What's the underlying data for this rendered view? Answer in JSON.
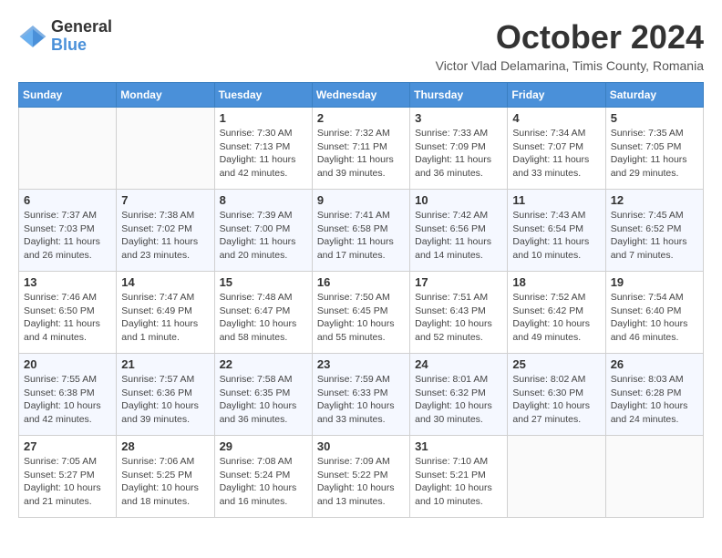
{
  "header": {
    "logo_general": "General",
    "logo_blue": "Blue",
    "month_title": "October 2024",
    "subtitle": "Victor Vlad Delamarina, Timis County, Romania"
  },
  "days_of_week": [
    "Sunday",
    "Monday",
    "Tuesday",
    "Wednesday",
    "Thursday",
    "Friday",
    "Saturday"
  ],
  "weeks": [
    [
      {
        "day": "",
        "info": ""
      },
      {
        "day": "",
        "info": ""
      },
      {
        "day": "1",
        "info": "Sunrise: 7:30 AM\nSunset: 7:13 PM\nDaylight: 11 hours and 42 minutes."
      },
      {
        "day": "2",
        "info": "Sunrise: 7:32 AM\nSunset: 7:11 PM\nDaylight: 11 hours and 39 minutes."
      },
      {
        "day": "3",
        "info": "Sunrise: 7:33 AM\nSunset: 7:09 PM\nDaylight: 11 hours and 36 minutes."
      },
      {
        "day": "4",
        "info": "Sunrise: 7:34 AM\nSunset: 7:07 PM\nDaylight: 11 hours and 33 minutes."
      },
      {
        "day": "5",
        "info": "Sunrise: 7:35 AM\nSunset: 7:05 PM\nDaylight: 11 hours and 29 minutes."
      }
    ],
    [
      {
        "day": "6",
        "info": "Sunrise: 7:37 AM\nSunset: 7:03 PM\nDaylight: 11 hours and 26 minutes."
      },
      {
        "day": "7",
        "info": "Sunrise: 7:38 AM\nSunset: 7:02 PM\nDaylight: 11 hours and 23 minutes."
      },
      {
        "day": "8",
        "info": "Sunrise: 7:39 AM\nSunset: 7:00 PM\nDaylight: 11 hours and 20 minutes."
      },
      {
        "day": "9",
        "info": "Sunrise: 7:41 AM\nSunset: 6:58 PM\nDaylight: 11 hours and 17 minutes."
      },
      {
        "day": "10",
        "info": "Sunrise: 7:42 AM\nSunset: 6:56 PM\nDaylight: 11 hours and 14 minutes."
      },
      {
        "day": "11",
        "info": "Sunrise: 7:43 AM\nSunset: 6:54 PM\nDaylight: 11 hours and 10 minutes."
      },
      {
        "day": "12",
        "info": "Sunrise: 7:45 AM\nSunset: 6:52 PM\nDaylight: 11 hours and 7 minutes."
      }
    ],
    [
      {
        "day": "13",
        "info": "Sunrise: 7:46 AM\nSunset: 6:50 PM\nDaylight: 11 hours and 4 minutes."
      },
      {
        "day": "14",
        "info": "Sunrise: 7:47 AM\nSunset: 6:49 PM\nDaylight: 11 hours and 1 minute."
      },
      {
        "day": "15",
        "info": "Sunrise: 7:48 AM\nSunset: 6:47 PM\nDaylight: 10 hours and 58 minutes."
      },
      {
        "day": "16",
        "info": "Sunrise: 7:50 AM\nSunset: 6:45 PM\nDaylight: 10 hours and 55 minutes."
      },
      {
        "day": "17",
        "info": "Sunrise: 7:51 AM\nSunset: 6:43 PM\nDaylight: 10 hours and 52 minutes."
      },
      {
        "day": "18",
        "info": "Sunrise: 7:52 AM\nSunset: 6:42 PM\nDaylight: 10 hours and 49 minutes."
      },
      {
        "day": "19",
        "info": "Sunrise: 7:54 AM\nSunset: 6:40 PM\nDaylight: 10 hours and 46 minutes."
      }
    ],
    [
      {
        "day": "20",
        "info": "Sunrise: 7:55 AM\nSunset: 6:38 PM\nDaylight: 10 hours and 42 minutes."
      },
      {
        "day": "21",
        "info": "Sunrise: 7:57 AM\nSunset: 6:36 PM\nDaylight: 10 hours and 39 minutes."
      },
      {
        "day": "22",
        "info": "Sunrise: 7:58 AM\nSunset: 6:35 PM\nDaylight: 10 hours and 36 minutes."
      },
      {
        "day": "23",
        "info": "Sunrise: 7:59 AM\nSunset: 6:33 PM\nDaylight: 10 hours and 33 minutes."
      },
      {
        "day": "24",
        "info": "Sunrise: 8:01 AM\nSunset: 6:32 PM\nDaylight: 10 hours and 30 minutes."
      },
      {
        "day": "25",
        "info": "Sunrise: 8:02 AM\nSunset: 6:30 PM\nDaylight: 10 hours and 27 minutes."
      },
      {
        "day": "26",
        "info": "Sunrise: 8:03 AM\nSunset: 6:28 PM\nDaylight: 10 hours and 24 minutes."
      }
    ],
    [
      {
        "day": "27",
        "info": "Sunrise: 7:05 AM\nSunset: 5:27 PM\nDaylight: 10 hours and 21 minutes."
      },
      {
        "day": "28",
        "info": "Sunrise: 7:06 AM\nSunset: 5:25 PM\nDaylight: 10 hours and 18 minutes."
      },
      {
        "day": "29",
        "info": "Sunrise: 7:08 AM\nSunset: 5:24 PM\nDaylight: 10 hours and 16 minutes."
      },
      {
        "day": "30",
        "info": "Sunrise: 7:09 AM\nSunset: 5:22 PM\nDaylight: 10 hours and 13 minutes."
      },
      {
        "day": "31",
        "info": "Sunrise: 7:10 AM\nSunset: 5:21 PM\nDaylight: 10 hours and 10 minutes."
      },
      {
        "day": "",
        "info": ""
      },
      {
        "day": "",
        "info": ""
      }
    ]
  ]
}
